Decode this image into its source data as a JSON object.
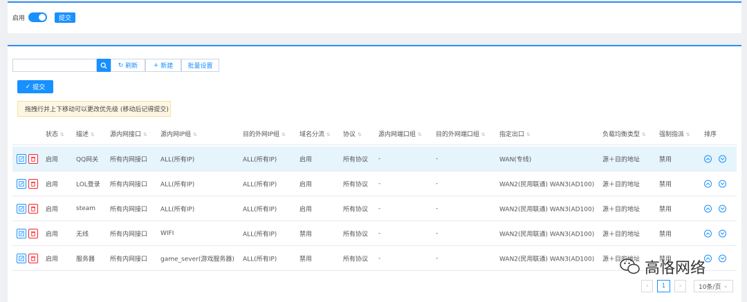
{
  "top": {
    "enable_label": "启用",
    "enable_on": true,
    "submit_label": "提交"
  },
  "toolbar": {
    "search_placeholder": "",
    "refresh_label": "刷新",
    "new_label": "新建",
    "batch_label": "批量设置",
    "submit_label": "提交"
  },
  "notice": "拖拽行并上下移动可以更改优先级 (移动后记得提交)",
  "columns": [
    "状态",
    "描述",
    "源内网接口",
    "源内网IP组",
    "目的外网IP组",
    "域名分流",
    "协议",
    "源内网端口组",
    "目的外网端口组",
    "指定出口",
    "负载均衡类型",
    "强制指派",
    "排序"
  ],
  "rows": [
    {
      "status": "启用",
      "desc": "QQ网关",
      "src_if": "所有内网接口",
      "src_ip": "ALL(所有IP)",
      "dst_ip": "ALL(所有IP)",
      "domain": "启用",
      "proto": "所有协议",
      "src_port": "-",
      "dst_port": "-",
      "exit": "WAN(专线)",
      "lb": "源＋目的地址",
      "force": "禁用"
    },
    {
      "status": "启用",
      "desc": "LOL登录",
      "src_if": "所有内网接口",
      "src_ip": "ALL(所有IP)",
      "dst_ip": "ALL(所有IP)",
      "domain": "启用",
      "proto": "所有协议",
      "src_port": "-",
      "dst_port": "-",
      "exit": "WAN2(民用联通) WAN3(AD100)",
      "lb": "源＋目的地址",
      "force": "禁用"
    },
    {
      "status": "启用",
      "desc": "steam",
      "src_if": "所有内网接口",
      "src_ip": "ALL(所有IP)",
      "dst_ip": "ALL(所有IP)",
      "domain": "启用",
      "proto": "所有协议",
      "src_port": "-",
      "dst_port": "-",
      "exit": "WAN2(民用联通) WAN3(AD100)",
      "lb": "源＋目的地址",
      "force": "禁用"
    },
    {
      "status": "启用",
      "desc": "无线",
      "src_if": "所有内网接口",
      "src_ip": "WIFI",
      "dst_ip": "ALL(所有IP)",
      "domain": "禁用",
      "proto": "所有协议",
      "src_port": "-",
      "dst_port": "-",
      "exit": "WAN2(民用联通) WAN3(AD100)",
      "lb": "源＋目的地址",
      "force": "禁用"
    },
    {
      "status": "启用",
      "desc": "服务器",
      "src_if": "所有内网接口",
      "src_ip": "game_sever(游戏服务器)",
      "dst_ip": "ALL(所有IP)",
      "domain": "禁用",
      "proto": "所有协议",
      "src_port": "-",
      "dst_port": "-",
      "exit": "WAN2(民用联通) WAN3(AD100)",
      "lb": "源＋目的地址",
      "force": "禁用"
    }
  ],
  "pagination": {
    "prev": "‹",
    "page": "1",
    "next": "›",
    "page_size": "10条/页"
  },
  "watermark": "高恪网络",
  "colors": {
    "accent": "#1890ff",
    "danger": "#f5222d",
    "notice_bg": "#fdf6e3",
    "row_highlight": "#e6f4fc"
  }
}
